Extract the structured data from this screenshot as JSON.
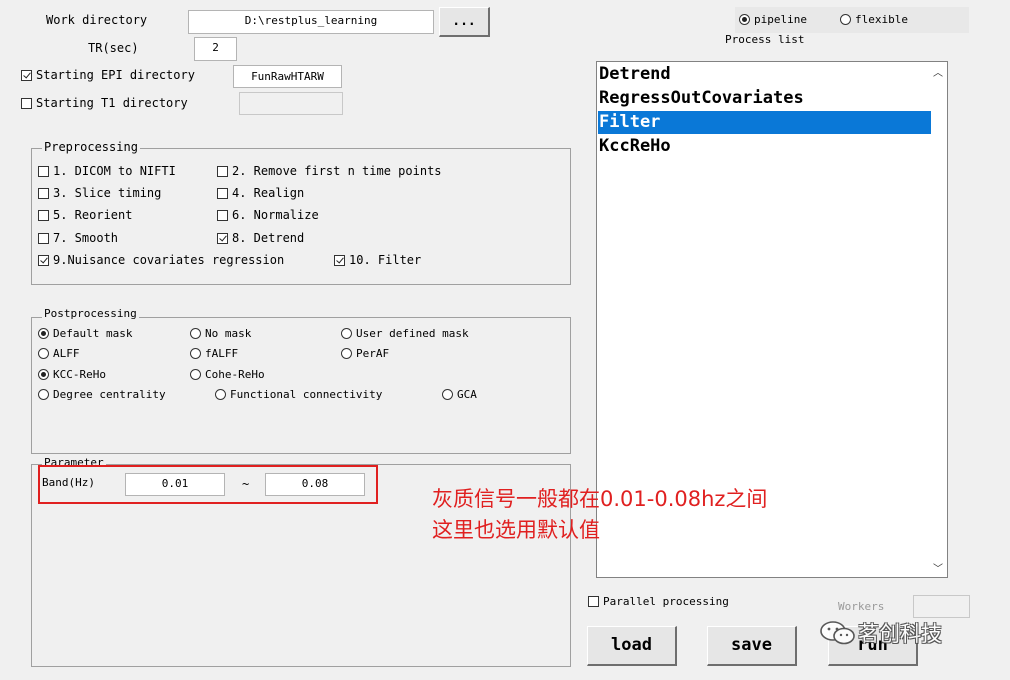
{
  "top": {
    "work_dir_label": "Work directory",
    "work_dir_value": "D:\\restplus_learning",
    "browse_label": "...",
    "tr_label": "TR(sec)",
    "tr_value": "2",
    "epi_label": "Starting EPI directory",
    "epi_value": "FunRawHTARW",
    "t1_label": "Starting T1 directory",
    "t1_value": ""
  },
  "mode": {
    "pipeline": "pipeline",
    "flexible": "flexible",
    "selected": "pipeline"
  },
  "process_list": {
    "title": "Process list",
    "items": [
      "Detrend",
      "RegressOutCovariates",
      "Filter",
      "KccReHo"
    ],
    "selected": "Filter"
  },
  "preprocessing": {
    "title": "Preprocessing",
    "items": [
      {
        "label": "1. DICOM to NIFTI",
        "checked": false
      },
      {
        "label": "2. Remove first n time points",
        "checked": false
      },
      {
        "label": "3. Slice timing",
        "checked": false
      },
      {
        "label": "4. Realign",
        "checked": false
      },
      {
        "label": "5. Reorient",
        "checked": false
      },
      {
        "label": "6. Normalize",
        "checked": false
      },
      {
        "label": "7. Smooth",
        "checked": false
      },
      {
        "label": "8. Detrend",
        "checked": true
      },
      {
        "label": "9.Nuisance covariates regression",
        "checked": true
      },
      {
        "label": "10. Filter",
        "checked": true
      }
    ]
  },
  "postprocessing": {
    "title": "Postprocessing",
    "items": [
      {
        "label": "Default mask",
        "checked": true
      },
      {
        "label": "No mask",
        "checked": false
      },
      {
        "label": "User defined mask",
        "checked": false
      },
      {
        "label": "ALFF",
        "checked": false
      },
      {
        "label": "fALFF",
        "checked": false
      },
      {
        "label": "PerAF",
        "checked": false
      },
      {
        "label": "KCC-ReHo",
        "checked": true
      },
      {
        "label": "Cohe-ReHo",
        "checked": false
      },
      {
        "label": "Degree centrality",
        "checked": false
      },
      {
        "label": "Functional connectivity",
        "checked": false
      },
      {
        "label": "GCA",
        "checked": false
      }
    ]
  },
  "parameter": {
    "title": "Parameter",
    "band_label": "Band(Hz)",
    "low": "0.01",
    "tilde": "~",
    "high": "0.08"
  },
  "bottom": {
    "parallel_label": "Parallel processing",
    "parallel_checked": false,
    "workers_label": "Workers",
    "workers_value": "",
    "load_label": "load",
    "save_label": "save",
    "run_label": "run"
  },
  "annotation": {
    "line1": "灰质信号一般都在0.01-0.08hz之间",
    "line2": "这里也选用默认值",
    "color": "#e02020"
  },
  "watermark": {
    "text": "茗创科技"
  }
}
